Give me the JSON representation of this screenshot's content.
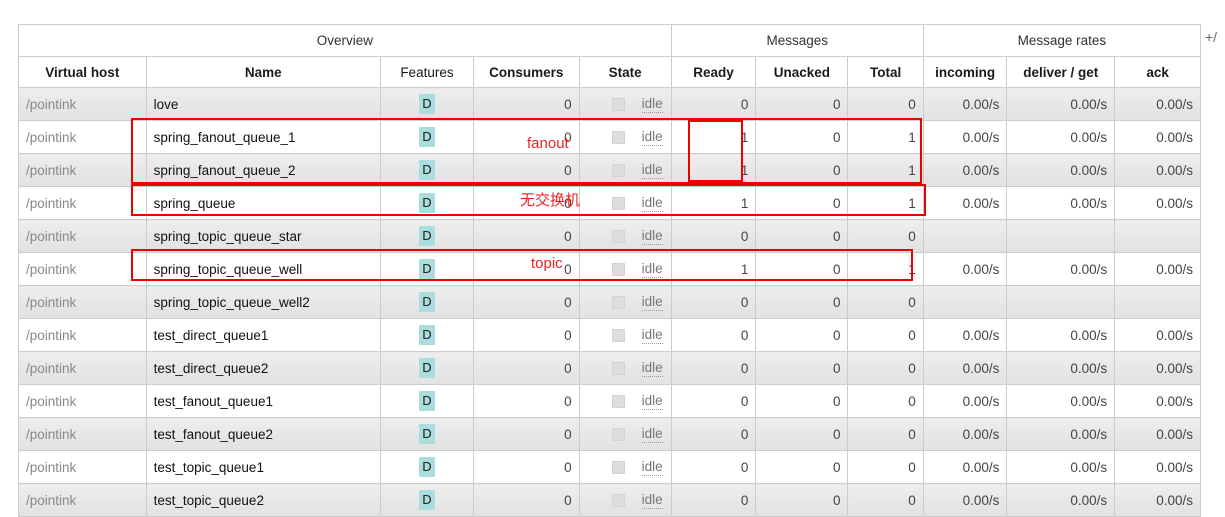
{
  "table": {
    "group_headers": [
      {
        "label": "Overview",
        "span": 5
      },
      {
        "label": "Messages",
        "span": 3
      },
      {
        "label": "Message rates",
        "span": 3
      }
    ],
    "toggle_label": "+/",
    "columns": [
      {
        "key": "vhost",
        "label": "Virtual host",
        "bold": true
      },
      {
        "key": "name",
        "label": "Name",
        "bold": true
      },
      {
        "key": "features",
        "label": "Features",
        "bold": false
      },
      {
        "key": "consumers",
        "label": "Consumers",
        "bold": true
      },
      {
        "key": "state",
        "label": "State",
        "bold": true
      },
      {
        "key": "ready",
        "label": "Ready",
        "bold": true
      },
      {
        "key": "unacked",
        "label": "Unacked",
        "bold": true
      },
      {
        "key": "total",
        "label": "Total",
        "bold": true
      },
      {
        "key": "incoming",
        "label": "incoming",
        "bold": true
      },
      {
        "key": "deliver",
        "label": "deliver / get",
        "bold": true
      },
      {
        "key": "ack",
        "label": "ack",
        "bold": true
      }
    ],
    "feature_badge_label": "D",
    "state_icon": "square-chip-icon",
    "rows": [
      {
        "vhost": "/pointink",
        "name": "love",
        "features": "D",
        "consumers": "0",
        "state": "idle",
        "ready": "0",
        "unacked": "0",
        "total": "0",
        "incoming": "0.00/s",
        "deliver": "0.00/s",
        "ack": "0.00/s"
      },
      {
        "vhost": "/pointink",
        "name": "spring_fanout_queue_1",
        "features": "D",
        "consumers": "0",
        "state": "idle",
        "ready": "1",
        "unacked": "0",
        "total": "1",
        "incoming": "0.00/s",
        "deliver": "0.00/s",
        "ack": "0.00/s"
      },
      {
        "vhost": "/pointink",
        "name": "spring_fanout_queue_2",
        "features": "D",
        "consumers": "0",
        "state": "idle",
        "ready": "1",
        "unacked": "0",
        "total": "1",
        "incoming": "0.00/s",
        "deliver": "0.00/s",
        "ack": "0.00/s"
      },
      {
        "vhost": "/pointink",
        "name": "spring_queue",
        "features": "D",
        "consumers": "0",
        "state": "idle",
        "ready": "1",
        "unacked": "0",
        "total": "1",
        "incoming": "0.00/s",
        "deliver": "0.00/s",
        "ack": "0.00/s"
      },
      {
        "vhost": "/pointink",
        "name": "spring_topic_queue_star",
        "features": "D",
        "consumers": "0",
        "state": "idle",
        "ready": "0",
        "unacked": "0",
        "total": "0",
        "incoming": "",
        "deliver": "",
        "ack": ""
      },
      {
        "vhost": "/pointink",
        "name": "spring_topic_queue_well",
        "features": "D",
        "consumers": "0",
        "state": "idle",
        "ready": "1",
        "unacked": "0",
        "total": "1",
        "incoming": "0.00/s",
        "deliver": "0.00/s",
        "ack": "0.00/s"
      },
      {
        "vhost": "/pointink",
        "name": "spring_topic_queue_well2",
        "features": "D",
        "consumers": "0",
        "state": "idle",
        "ready": "0",
        "unacked": "0",
        "total": "0",
        "incoming": "",
        "deliver": "",
        "ack": ""
      },
      {
        "vhost": "/pointink",
        "name": "test_direct_queue1",
        "features": "D",
        "consumers": "0",
        "state": "idle",
        "ready": "0",
        "unacked": "0",
        "total": "0",
        "incoming": "0.00/s",
        "deliver": "0.00/s",
        "ack": "0.00/s"
      },
      {
        "vhost": "/pointink",
        "name": "test_direct_queue2",
        "features": "D",
        "consumers": "0",
        "state": "idle",
        "ready": "0",
        "unacked": "0",
        "total": "0",
        "incoming": "0.00/s",
        "deliver": "0.00/s",
        "ack": "0.00/s"
      },
      {
        "vhost": "/pointink",
        "name": "test_fanout_queue1",
        "features": "D",
        "consumers": "0",
        "state": "idle",
        "ready": "0",
        "unacked": "0",
        "total": "0",
        "incoming": "0.00/s",
        "deliver": "0.00/s",
        "ack": "0.00/s"
      },
      {
        "vhost": "/pointink",
        "name": "test_fanout_queue2",
        "features": "D",
        "consumers": "0",
        "state": "idle",
        "ready": "0",
        "unacked": "0",
        "total": "0",
        "incoming": "0.00/s",
        "deliver": "0.00/s",
        "ack": "0.00/s"
      },
      {
        "vhost": "/pointink",
        "name": "test_topic_queue1",
        "features": "D",
        "consumers": "0",
        "state": "idle",
        "ready": "0",
        "unacked": "0",
        "total": "0",
        "incoming": "0.00/s",
        "deliver": "0.00/s",
        "ack": "0.00/s"
      },
      {
        "vhost": "/pointink",
        "name": "test_topic_queue2",
        "features": "D",
        "consumers": "0",
        "state": "idle",
        "ready": "0",
        "unacked": "0",
        "total": "0",
        "incoming": "0.00/s",
        "deliver": "0.00/s",
        "ack": "0.00/s"
      }
    ]
  },
  "annotations": {
    "color": "#ee0000",
    "labels": [
      {
        "id": "fanout",
        "text": "fanout"
      },
      {
        "id": "no-exchange",
        "text": "无交换机"
      },
      {
        "id": "topic",
        "text": "topic"
      }
    ]
  }
}
